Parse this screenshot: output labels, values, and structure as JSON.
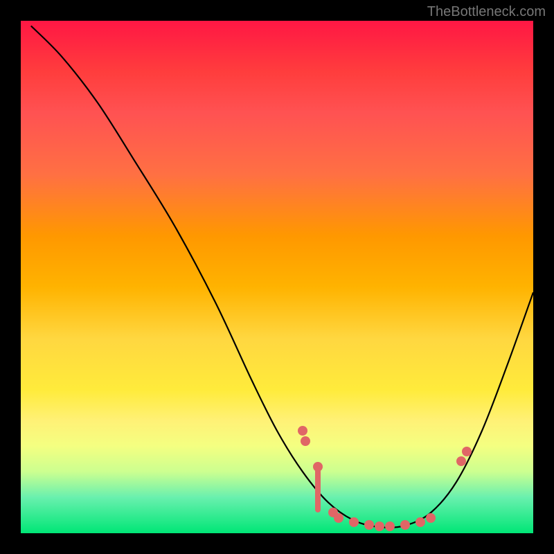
{
  "attribution": "TheBottleneck.com",
  "chart_data": {
    "type": "line",
    "title": "",
    "xlabel": "",
    "ylabel": "",
    "xlim": [
      0,
      100
    ],
    "ylim": [
      0,
      100
    ],
    "curve": [
      {
        "x": 2,
        "y": 99
      },
      {
        "x": 8,
        "y": 93
      },
      {
        "x": 15,
        "y": 84
      },
      {
        "x": 22,
        "y": 73
      },
      {
        "x": 30,
        "y": 60
      },
      {
        "x": 38,
        "y": 45
      },
      {
        "x": 45,
        "y": 30
      },
      {
        "x": 50,
        "y": 20
      },
      {
        "x": 55,
        "y": 12
      },
      {
        "x": 60,
        "y": 6
      },
      {
        "x": 65,
        "y": 2.5
      },
      {
        "x": 70,
        "y": 1.2
      },
      {
        "x": 75,
        "y": 1.5
      },
      {
        "x": 80,
        "y": 4
      },
      {
        "x": 85,
        "y": 10
      },
      {
        "x": 90,
        "y": 20
      },
      {
        "x": 95,
        "y": 33
      },
      {
        "x": 100,
        "y": 47
      }
    ],
    "points": [
      {
        "x": 55,
        "y": 20
      },
      {
        "x": 55.5,
        "y": 18
      },
      {
        "x": 58,
        "y": 13
      },
      {
        "x": 61,
        "y": 4
      },
      {
        "x": 62,
        "y": 3
      },
      {
        "x": 65,
        "y": 2.2
      },
      {
        "x": 68,
        "y": 1.6
      },
      {
        "x": 70,
        "y": 1.3
      },
      {
        "x": 72,
        "y": 1.3
      },
      {
        "x": 75,
        "y": 1.6
      },
      {
        "x": 78,
        "y": 2.2
      },
      {
        "x": 80,
        "y": 3
      },
      {
        "x": 86,
        "y": 14
      },
      {
        "x": 87,
        "y": 16
      }
    ],
    "bar_at": {
      "x": 58,
      "y_bottom": 4,
      "y_top": 13
    }
  }
}
